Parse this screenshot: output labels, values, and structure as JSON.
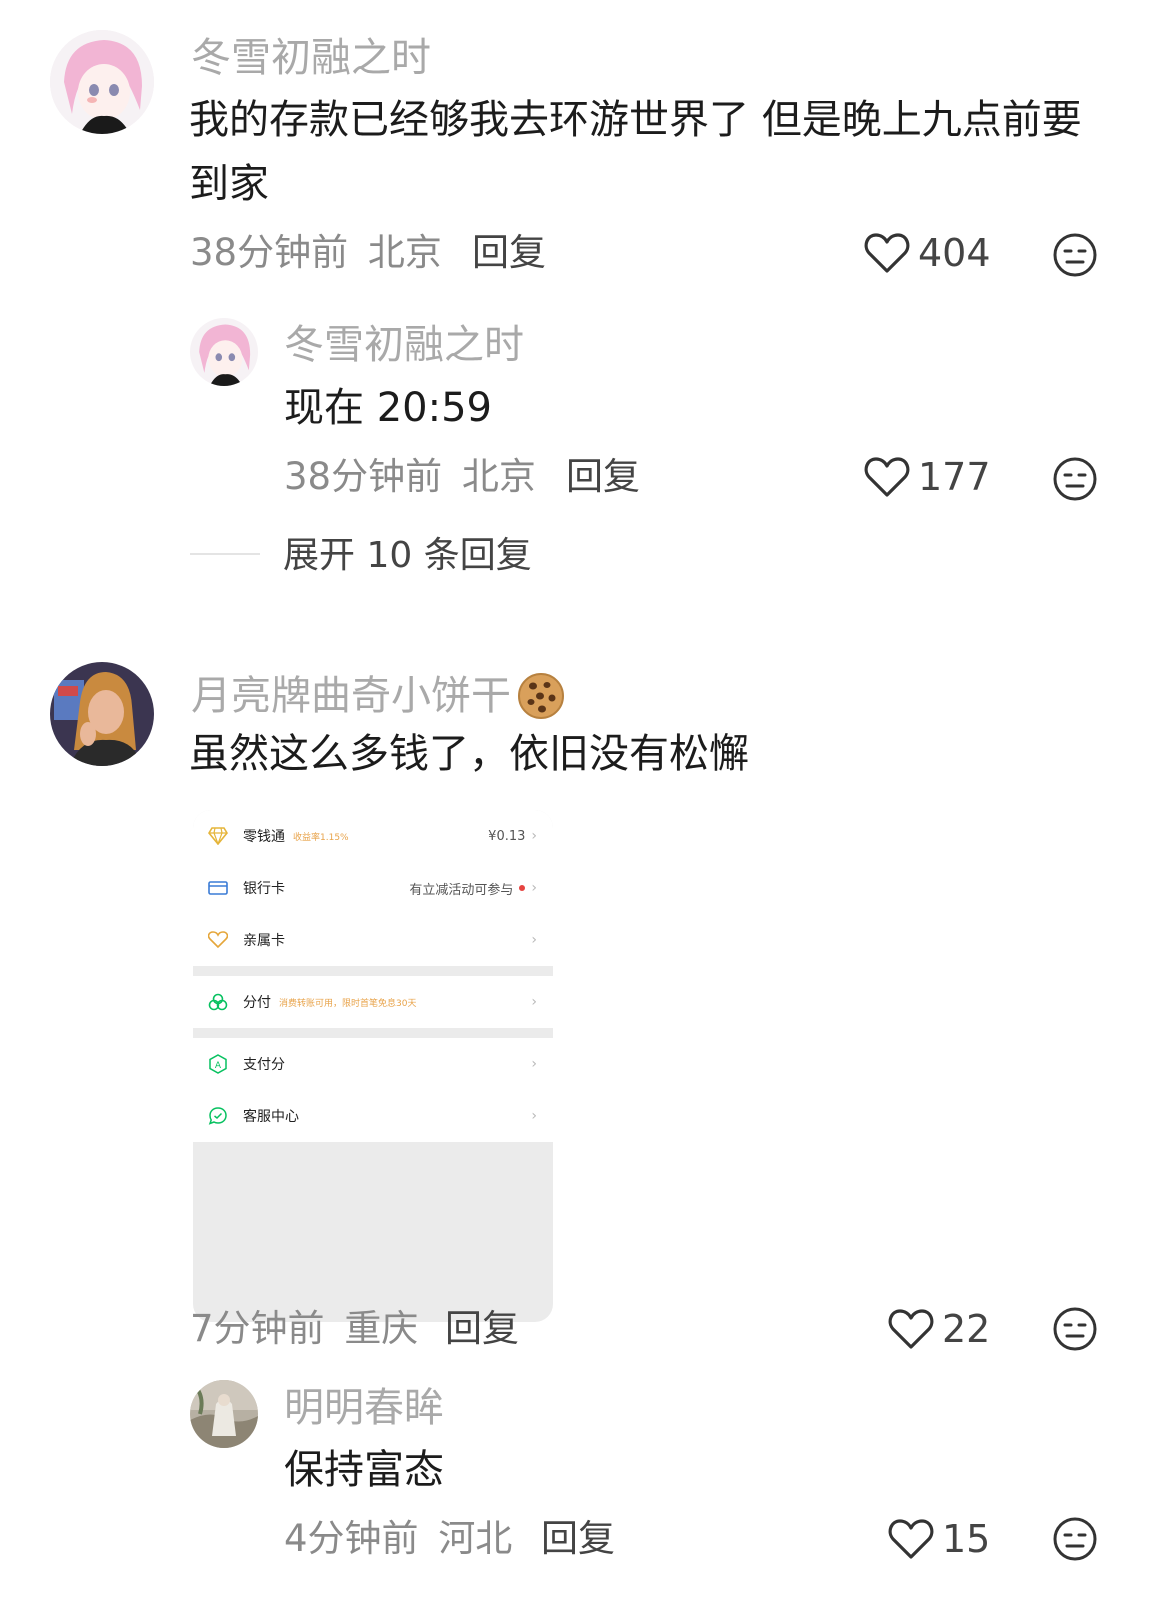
{
  "comments": [
    {
      "username": "冬雪初融之时",
      "content_lines": [
        "我的存款已经够我去环游世界了 但是晚上九点前要",
        "到家"
      ],
      "time": "38分钟前",
      "location": "北京",
      "reply_label": "回复",
      "likes": "404",
      "replies": [
        {
          "username": "冬雪初融之时",
          "content": "现在 20:59",
          "time": "38分钟前",
          "location": "北京",
          "reply_label": "回复",
          "likes": "177"
        }
      ],
      "expand_label": "展开 10 条回复"
    },
    {
      "username": "月亮牌曲奇小饼干",
      "username_emoji": "cookie-emoji",
      "content": "虽然这么多钱了，依旧没有松懈",
      "attachment": {
        "items": [
          {
            "icon": "diamond-icon",
            "label": "零钱通",
            "tag": "收益率1.15%",
            "value": "¥0.13"
          },
          {
            "icon": "card-icon",
            "label": "银行卡",
            "value": "有立减活动可参与",
            "badge_dot": true
          },
          {
            "icon": "heart-card-icon",
            "label": "亲属卡",
            "value": ""
          },
          {
            "icon": "fenfu-icon",
            "label": "分付",
            "tag": "消费转账可用，限时首笔免息30天",
            "value": ""
          },
          {
            "icon": "score-icon",
            "label": "支付分",
            "value": ""
          },
          {
            "icon": "service-icon",
            "label": "客服中心",
            "value": ""
          }
        ],
        "accent_color": "#07c160",
        "tag_color": "#e8a34a"
      },
      "time": "7分钟前",
      "location": "重庆",
      "reply_label": "回复",
      "likes": "22",
      "replies": [
        {
          "username": "明明春眸",
          "content": "保持富态",
          "time": "4分钟前",
          "location": "河北",
          "reply_label": "回复",
          "likes": "15"
        }
      ]
    }
  ],
  "icons": {
    "like": "heart-outline-icon",
    "dislike": "meh-face-icon"
  },
  "colors": {
    "username": "#a9a9a9",
    "meta": "#8a8a8a",
    "text": "#1c1c1c",
    "icon": "#333333"
  }
}
